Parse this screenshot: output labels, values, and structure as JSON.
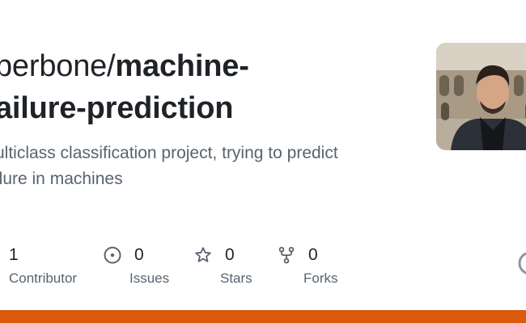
{
  "repo": {
    "owner": "perbone/",
    "name": "machine-",
    "name_line2": "ailure-prediction",
    "description_line1": "ulticlass classification project, trying to predict",
    "description_line2": "ilure in machines"
  },
  "stats": {
    "contributors": {
      "value": "1",
      "label": "Contributor",
      "icon": "people-icon"
    },
    "issues": {
      "value": "0",
      "label": "Issues",
      "icon": "issue-opened-icon"
    },
    "stars": {
      "value": "0",
      "label": "Stars",
      "icon": "star-icon"
    },
    "forks": {
      "value": "0",
      "label": "Forks",
      "icon": "repo-forked-icon"
    }
  },
  "colors": {
    "language_bar": "#DA5B0B",
    "text_primary": "#1f2328",
    "text_secondary": "#59636e"
  }
}
